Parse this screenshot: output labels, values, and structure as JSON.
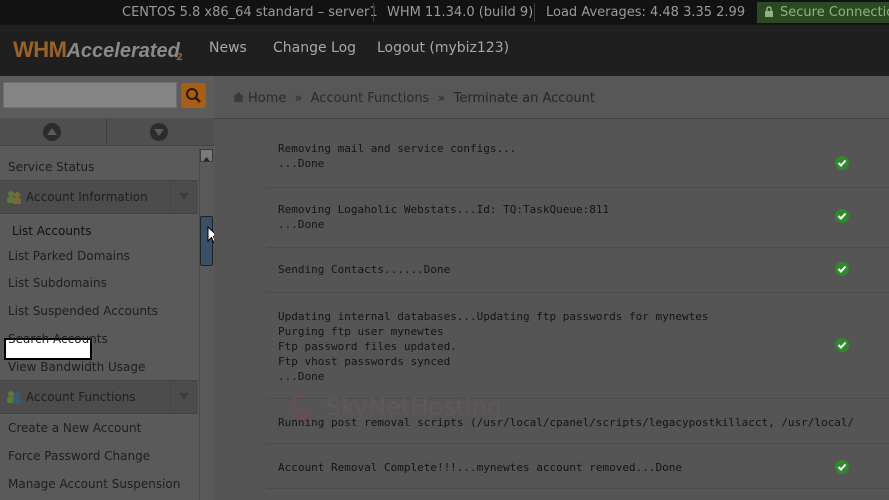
{
  "infobar": {
    "os": "CENTOS 5.8 x86_64 standard – server1",
    "version": "WHM 11.34.0 (build 9)",
    "load": "Load Averages: 4.48 3.35 2.99",
    "secure": "Secure Connection"
  },
  "header": {
    "logo_whm": "WHM",
    "logo_accelerated": "Accelerated",
    "logo_version": "2",
    "nav": {
      "news": "News",
      "changelog": "Change Log",
      "logout": "Logout (mybiz123)"
    }
  },
  "search": {
    "placeholder": ""
  },
  "breadcrumb": {
    "home": "Home",
    "sep": "»",
    "section": "Account Functions",
    "current": "Terminate an Account"
  },
  "sidebar": {
    "service_status": "Service Status",
    "account_information": {
      "title": "Account Information",
      "items": [
        "List Accounts",
        "List Parked Domains",
        "List Subdomains",
        "List Suspended Accounts",
        "Search Accounts",
        "View Bandwidth Usage"
      ]
    },
    "account_functions": {
      "title": "Account Functions",
      "items": [
        "Create a New Account",
        "Force Password Change",
        "Manage Account Suspension"
      ]
    }
  },
  "log": [
    {
      "text": "Removing mail and service configs...\n...Done",
      "status": "ok"
    },
    {
      "text": "Removing Logaholic Webstats...Id: TQ:TaskQueue:811\n...Done",
      "status": "ok"
    },
    {
      "text": "Sending Contacts......Done",
      "status": "ok"
    },
    {
      "text": "Updating internal databases...Updating ftp passwords for mynewtes\nPurging ftp user mynewtes\nFtp password files updated.\nFtp vhost passwords synced\n...Done",
      "status": "ok"
    },
    {
      "text": "Running post removal scripts (/usr/local/cpanel/scripts/legacypostkillacct, /usr/local/",
      "status": ""
    },
    {
      "text": "Account Removal Complete!!!...mynewtes account removed...Done",
      "status": "ok"
    }
  ],
  "watermark": "SkyNetHosting",
  "colors": {
    "accent": "#a85f14",
    "ok_green": "#2f8a2b",
    "secure_green": "#2b4a22"
  }
}
